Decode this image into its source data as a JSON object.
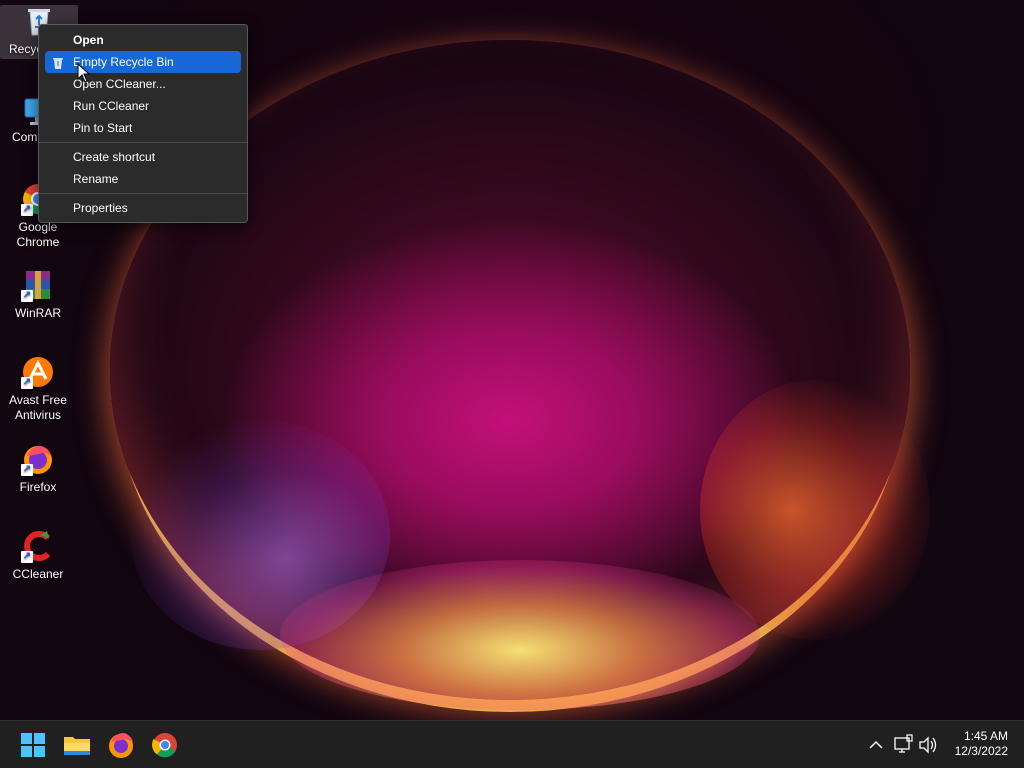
{
  "desktop": {
    "icons": [
      {
        "label": "Recycle Bin",
        "visible_label": "Recyc"
      },
      {
        "label": "Computer",
        "visible_label": "Com"
      },
      {
        "label": "Google Chrome",
        "line1": "Google",
        "line2": "Chrome"
      },
      {
        "label": "WinRAR"
      },
      {
        "label": "Avast Free Antivirus",
        "line1": "Avast Free",
        "line2": "Antivirus"
      },
      {
        "label": "Firefox"
      },
      {
        "label": "CCleaner"
      }
    ]
  },
  "context_menu": {
    "items": [
      {
        "label": "Open",
        "bold": true
      },
      {
        "label": "Empty Recycle Bin",
        "highlighted": true,
        "icon": "recycle-bin-icon"
      },
      {
        "label": "Open CCleaner..."
      },
      {
        "label": "Run CCleaner"
      },
      {
        "label": "Pin to Start"
      },
      {
        "label": "Create shortcut"
      },
      {
        "label": "Rename"
      },
      {
        "label": "Properties"
      }
    ]
  },
  "taskbar": {
    "pinned": [
      "start-icon",
      "file-explorer-icon",
      "firefox-icon",
      "chrome-icon"
    ],
    "tray": [
      "chevron-up-icon",
      "network-icon",
      "volume-icon"
    ],
    "clock": {
      "time": "1:45 AM",
      "date": "12/3/2022"
    }
  },
  "colors": {
    "menu_bg": "#2b2b2b",
    "menu_highlight": "#1668d8",
    "taskbar_bg": "#202020"
  }
}
